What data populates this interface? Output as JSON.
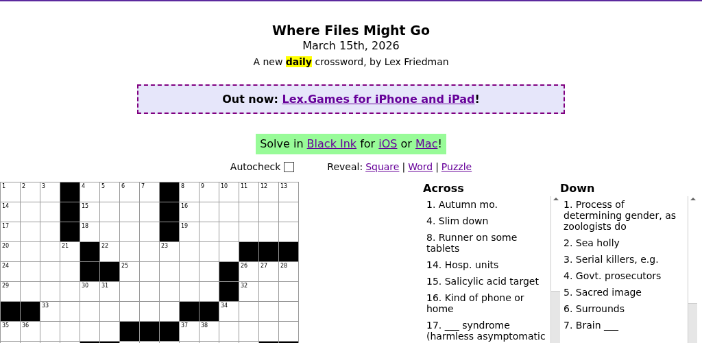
{
  "title": "Where Files Might Go",
  "date": "March 15th, 2026",
  "byline": "A new **daily** crossword, by Lex Friedman",
  "banner": {
    "prefix": "Out now: ",
    "link": "Lex.Games for iPhone and iPad",
    "suffix": "!"
  },
  "solve": [
    {
      "kind": "text",
      "text": "Solve in "
    },
    {
      "kind": "link",
      "text": "Black Ink"
    },
    {
      "kind": "text",
      "text": " for "
    },
    {
      "kind": "link",
      "text": "iOS"
    },
    {
      "kind": "text",
      "text": " or "
    },
    {
      "kind": "link",
      "text": "Mac"
    },
    {
      "kind": "text",
      "text": "!"
    }
  ],
  "autocheck": {
    "label": "Autocheck",
    "checked": false
  },
  "reveal": {
    "label": "Reveal:",
    "items": [
      {
        "kind": "link",
        "text": "Square"
      },
      {
        "kind": "separator",
        "text": "|"
      },
      {
        "kind": "link",
        "text": "Word"
      },
      {
        "kind": "separator",
        "text": "|"
      },
      {
        "kind": "link",
        "text": "Puzzle"
      }
    ]
  },
  "grid": {
    "rows": [
      [
        {
          "kind": "open",
          "number": "1"
        },
        {
          "kind": "open",
          "number": "2"
        },
        {
          "kind": "open",
          "number": "3"
        },
        {
          "kind": "black"
        },
        {
          "kind": "open",
          "number": "4"
        },
        {
          "kind": "open",
          "number": "5"
        },
        {
          "kind": "open",
          "number": "6"
        },
        {
          "kind": "open",
          "number": "7"
        },
        {
          "kind": "black"
        },
        {
          "kind": "open",
          "number": "8"
        },
        {
          "kind": "open",
          "number": "9"
        },
        {
          "kind": "open",
          "number": "10"
        },
        {
          "kind": "open",
          "number": "11"
        },
        {
          "kind": "open",
          "number": "12"
        },
        {
          "kind": "open",
          "number": "13"
        }
      ],
      [
        {
          "kind": "open",
          "number": "14"
        },
        {
          "kind": "open"
        },
        {
          "kind": "open"
        },
        {
          "kind": "black"
        },
        {
          "kind": "open",
          "number": "15"
        },
        {
          "kind": "open"
        },
        {
          "kind": "open"
        },
        {
          "kind": "open"
        },
        {
          "kind": "black"
        },
        {
          "kind": "open",
          "number": "16"
        },
        {
          "kind": "open"
        },
        {
          "kind": "open"
        },
        {
          "kind": "open"
        },
        {
          "kind": "open"
        },
        {
          "kind": "open"
        }
      ],
      [
        {
          "kind": "open",
          "number": "17"
        },
        {
          "kind": "open"
        },
        {
          "kind": "open"
        },
        {
          "kind": "black"
        },
        {
          "kind": "open",
          "number": "18"
        },
        {
          "kind": "open"
        },
        {
          "kind": "open"
        },
        {
          "kind": "open"
        },
        {
          "kind": "black"
        },
        {
          "kind": "open",
          "number": "19"
        },
        {
          "kind": "open"
        },
        {
          "kind": "open"
        },
        {
          "kind": "open"
        },
        {
          "kind": "open"
        },
        {
          "kind": "open"
        }
      ],
      [
        {
          "kind": "open",
          "number": "20"
        },
        {
          "kind": "open"
        },
        {
          "kind": "open"
        },
        {
          "kind": "open",
          "number": "21"
        },
        {
          "kind": "black"
        },
        {
          "kind": "open",
          "number": "22"
        },
        {
          "kind": "open"
        },
        {
          "kind": "open"
        },
        {
          "kind": "open",
          "number": "23"
        },
        {
          "kind": "open"
        },
        {
          "kind": "open"
        },
        {
          "kind": "open"
        },
        {
          "kind": "black"
        },
        {
          "kind": "black"
        },
        {
          "kind": "black"
        }
      ],
      [
        {
          "kind": "open",
          "number": "24"
        },
        {
          "kind": "open"
        },
        {
          "kind": "open"
        },
        {
          "kind": "open"
        },
        {
          "kind": "black"
        },
        {
          "kind": "black"
        },
        {
          "kind": "open",
          "number": "25"
        },
        {
          "kind": "open"
        },
        {
          "kind": "open"
        },
        {
          "kind": "open"
        },
        {
          "kind": "open"
        },
        {
          "kind": "black"
        },
        {
          "kind": "open",
          "number": "26"
        },
        {
          "kind": "open",
          "number": "27"
        },
        {
          "kind": "open",
          "number": "28"
        }
      ],
      [
        {
          "kind": "open",
          "number": "29"
        },
        {
          "kind": "open"
        },
        {
          "kind": "open"
        },
        {
          "kind": "open"
        },
        {
          "kind": "open",
          "number": "30"
        },
        {
          "kind": "open",
          "number": "31"
        },
        {
          "kind": "open"
        },
        {
          "kind": "open"
        },
        {
          "kind": "open"
        },
        {
          "kind": "open"
        },
        {
          "kind": "open"
        },
        {
          "kind": "black"
        },
        {
          "kind": "open",
          "number": "32"
        },
        {
          "kind": "open"
        },
        {
          "kind": "open"
        }
      ],
      [
        {
          "kind": "black"
        },
        {
          "kind": "black"
        },
        {
          "kind": "open",
          "number": "33"
        },
        {
          "kind": "open"
        },
        {
          "kind": "open"
        },
        {
          "kind": "open"
        },
        {
          "kind": "open"
        },
        {
          "kind": "open"
        },
        {
          "kind": "open"
        },
        {
          "kind": "black"
        },
        {
          "kind": "black"
        },
        {
          "kind": "open",
          "number": "34"
        },
        {
          "kind": "open"
        },
        {
          "kind": "open"
        },
        {
          "kind": "open"
        }
      ],
      [
        {
          "kind": "open",
          "number": "35"
        },
        {
          "kind": "open",
          "number": "36"
        },
        {
          "kind": "open"
        },
        {
          "kind": "open"
        },
        {
          "kind": "open"
        },
        {
          "kind": "open"
        },
        {
          "kind": "black"
        },
        {
          "kind": "black"
        },
        {
          "kind": "black"
        },
        {
          "kind": "open",
          "number": "37"
        },
        {
          "kind": "open",
          "number": "38"
        },
        {
          "kind": "open"
        },
        {
          "kind": "open"
        },
        {
          "kind": "open"
        },
        {
          "kind": "open"
        }
      ],
      [
        {
          "kind": "open"
        },
        {
          "kind": "open"
        },
        {
          "kind": "open"
        },
        {
          "kind": "open"
        },
        {
          "kind": "black"
        },
        {
          "kind": "black"
        },
        {
          "kind": "open"
        },
        {
          "kind": "open"
        },
        {
          "kind": "open"
        },
        {
          "kind": "open"
        },
        {
          "kind": "open"
        },
        {
          "kind": "open"
        },
        {
          "kind": "open"
        },
        {
          "kind": "black"
        },
        {
          "kind": "black"
        }
      ]
    ]
  },
  "across": {
    "title": "Across",
    "clues": [
      "1. Autumn mo.",
      "4. Slim down",
      "8. Runner on some tablets",
      "14. Hosp. units",
      "15. Salicylic acid target",
      "16. Kind of phone or home",
      "17. ___ syndrome (harmless asymptomatic"
    ]
  },
  "down": {
    "title": "Down",
    "clues": [
      "1. Process of determining gender, as zoologists do",
      "2. Sea holly",
      "3. Serial killers, e.g.",
      "4. Govt. prosecutors",
      "5. Sacred image",
      "6. Surrounds",
      "7. Brain ___"
    ]
  }
}
